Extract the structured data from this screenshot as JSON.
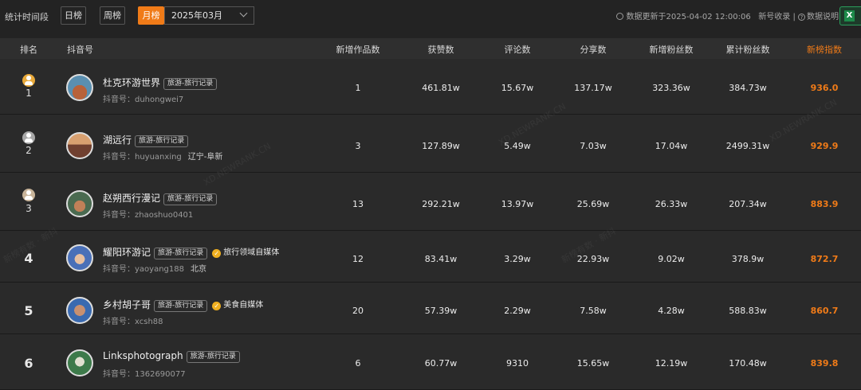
{
  "toolbar": {
    "period_label": "统计时间段",
    "day_label": "日榜",
    "week_label": "周榜",
    "month_label": "月榜",
    "month_value": "2025年03月",
    "update_text": "数据更新于2025-04-02 12:00:06",
    "submit_text": "新号收录",
    "sep": "|",
    "help_text": "数据说明",
    "excel_label": "X"
  },
  "table": {
    "headers": {
      "rank": "排名",
      "account": "抖音号",
      "new_works": "新增作品数",
      "likes": "获赞数",
      "comments": "评论数",
      "shares": "分享数",
      "new_fans": "新增粉丝数",
      "total_fans": "累计粉丝数",
      "index": "新榜指数"
    },
    "rows": [
      {
        "rank": "1",
        "name": "杜克环游世界",
        "tag": "旅游-旅行记录",
        "verify": "",
        "acct_prefix": "抖音号：",
        "acct": "duhongwei7",
        "location": "",
        "new_works": "1",
        "likes": "461.81w",
        "comments": "15.67w",
        "shares": "137.17w",
        "new_fans": "323.36w",
        "total_fans": "384.73w",
        "index": "936.0"
      },
      {
        "rank": "2",
        "name": "湖远行",
        "tag": "旅游-旅行记录",
        "verify": "",
        "acct_prefix": "抖音号：",
        "acct": "huyuanxing",
        "location": "辽宁-阜新",
        "new_works": "3",
        "likes": "127.89w",
        "comments": "5.49w",
        "shares": "7.03w",
        "new_fans": "17.04w",
        "total_fans": "2499.31w",
        "index": "929.9"
      },
      {
        "rank": "3",
        "name": "赵朔西行漫记",
        "tag": "旅游-旅行记录",
        "verify": "",
        "acct_prefix": "抖音号：",
        "acct": "zhaoshuo0401",
        "location": "",
        "new_works": "13",
        "likes": "292.21w",
        "comments": "13.97w",
        "shares": "25.69w",
        "new_fans": "26.33w",
        "total_fans": "207.34w",
        "index": "883.9"
      },
      {
        "rank": "4",
        "name": "耀阳环游记",
        "tag": "旅游-旅行记录",
        "verify": "旅行领域自媒体",
        "acct_prefix": "抖音号：",
        "acct": "yaoyang188",
        "location": "北京",
        "new_works": "12",
        "likes": "83.41w",
        "comments": "3.29w",
        "shares": "22.93w",
        "new_fans": "9.02w",
        "total_fans": "378.9w",
        "index": "872.7"
      },
      {
        "rank": "5",
        "name": "乡村胡子哥",
        "tag": "旅游-旅行记录",
        "verify": "美食自媒体",
        "acct_prefix": "抖音号：",
        "acct": "xcsh88",
        "location": "",
        "new_works": "20",
        "likes": "57.39w",
        "comments": "2.29w",
        "shares": "7.58w",
        "new_fans": "4.28w",
        "total_fans": "588.83w",
        "index": "860.7"
      },
      {
        "rank": "6",
        "name": "Linksphotograph",
        "tag": "旅游-旅行记录",
        "verify": "",
        "acct_prefix": "抖音号：",
        "acct": "1362690077",
        "location": "",
        "new_works": "6",
        "likes": "60.77w",
        "comments": "9310",
        "shares": "15.65w",
        "new_fans": "12.19w",
        "total_fans": "170.48w",
        "index": "839.8"
      }
    ]
  },
  "watermarks": {
    "site": "XD.NEWRANK.CN",
    "brand": "新榜有数 · 新抖"
  },
  "colors": {
    "accent": "#f07b18",
    "background": "#232323",
    "row_bg": "#2a2a2a",
    "header_bg": "#2f2f2f"
  }
}
